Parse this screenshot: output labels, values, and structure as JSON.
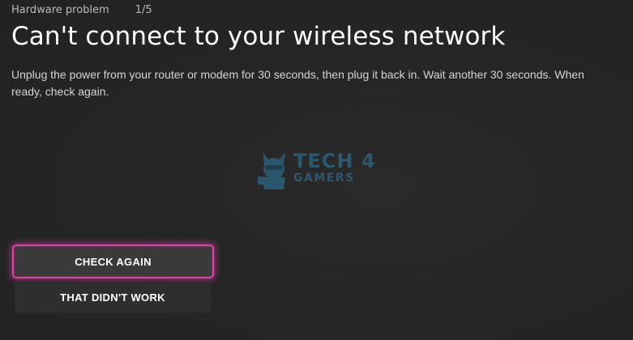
{
  "header": {
    "category": "Hardware problem",
    "step": "1/5"
  },
  "main": {
    "title": "Can't connect to your wireless network",
    "instructions": "Unplug the power from your router or modem for 30 seconds, then plug it back in. Wait another 30 seconds. When ready, check again."
  },
  "watermark": {
    "line1": "TECH 4",
    "line2": "GAMERS",
    "icon": "mascot-logo-icon",
    "color": "#2f7fa8"
  },
  "actions": {
    "check_again_label": "CHECK AGAIN",
    "didnt_work_label": "THAT DIDN'T WORK"
  },
  "colors": {
    "background": "#252525",
    "focus_glow": "#e040a8",
    "button_bg": "#3a3a3a"
  }
}
